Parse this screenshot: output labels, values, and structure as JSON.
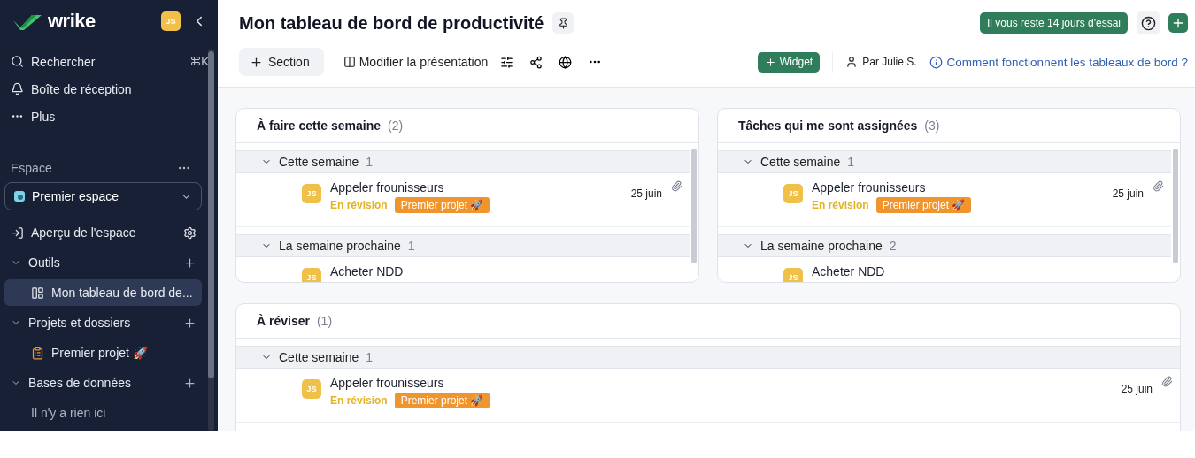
{
  "sidebar": {
    "logo": "wrike",
    "avatar": "JS",
    "nav": [
      {
        "kind": "search",
        "label": "Rechercher",
        "shortcut": "⌘K"
      },
      {
        "kind": "bell",
        "label": "Boîte de réception"
      },
      {
        "kind": "more",
        "label": "Plus"
      }
    ],
    "space_label": "Espace",
    "space_selector": "Premier espace",
    "tree": [
      {
        "kind": "link",
        "label": "Aperçu de l'espace"
      },
      {
        "kind": "group",
        "label": "Outils",
        "expanded": true,
        "children": [
          {
            "kind": "dashboard",
            "label": "Mon tableau de bord de...",
            "selected": true
          }
        ]
      },
      {
        "kind": "group",
        "label": "Projets et dossiers",
        "expanded": true,
        "children": [
          {
            "kind": "project",
            "label": "Premier projet 🚀",
            "selected": false
          }
        ]
      },
      {
        "kind": "group",
        "label": "Bases de données",
        "expanded": true,
        "children": [
          {
            "kind": "empty",
            "label": "Il n'y a rien ici",
            "selected": false
          }
        ]
      }
    ]
  },
  "header": {
    "title": "Mon tableau de bord de productivité",
    "trial_badge": "Il vous reste 14 jours d'essai",
    "toolbar": {
      "section_button": "Section",
      "layout_button": "Modifier la présentation",
      "widget_button": "Widget",
      "owner": "Par Julie S.",
      "help_link": "Comment fonctionnent les tableaux de bord ?"
    }
  },
  "widgets": [
    {
      "title": "À faire cette semaine",
      "count": "(2)",
      "groups": [
        {
          "label": "Cette semaine",
          "count": "1",
          "expanded": true,
          "tasks": [
            {
              "title": "Appeler frounisseurs",
              "avatar": "JS",
              "status": "En révision",
              "color": "#e2b325",
              "project": "Premier projet 🚀",
              "date": "25 juin",
              "attachment": true
            }
          ]
        },
        {
          "label": "La semaine prochaine",
          "count": "1",
          "expanded": true,
          "tasks": [
            {
              "title": "Acheter NDD",
              "avatar": "JS",
              "attachment": false
            }
          ]
        }
      ]
    },
    {
      "title": "Tâches qui me sont assignées",
      "count": "(3)",
      "groups": [
        {
          "label": "Cette semaine",
          "count": "1",
          "expanded": true,
          "tasks": [
            {
              "title": "Appeler frounisseurs",
              "avatar": "JS",
              "status": "En révision",
              "color": "#e2b325",
              "project": "Premier projet 🚀",
              "date": "25 juin",
              "attachment": true
            }
          ]
        },
        {
          "label": "La semaine prochaine",
          "count": "2",
          "expanded": true,
          "tasks": [
            {
              "title": "Acheter NDD",
              "avatar": "JS",
              "attachment": false
            }
          ]
        }
      ]
    },
    {
      "title": "À réviser",
      "count": "(1)",
      "groups": [
        {
          "label": "Cette semaine",
          "count": "1",
          "expanded": true,
          "tasks": [
            {
              "title": "Appeler frounisseurs",
              "avatar": "JS",
              "status": "En révision",
              "color": "#e2b325",
              "project": "Premier projet 🚀",
              "date": "25 juin",
              "attachment": true
            }
          ]
        }
      ]
    }
  ]
}
